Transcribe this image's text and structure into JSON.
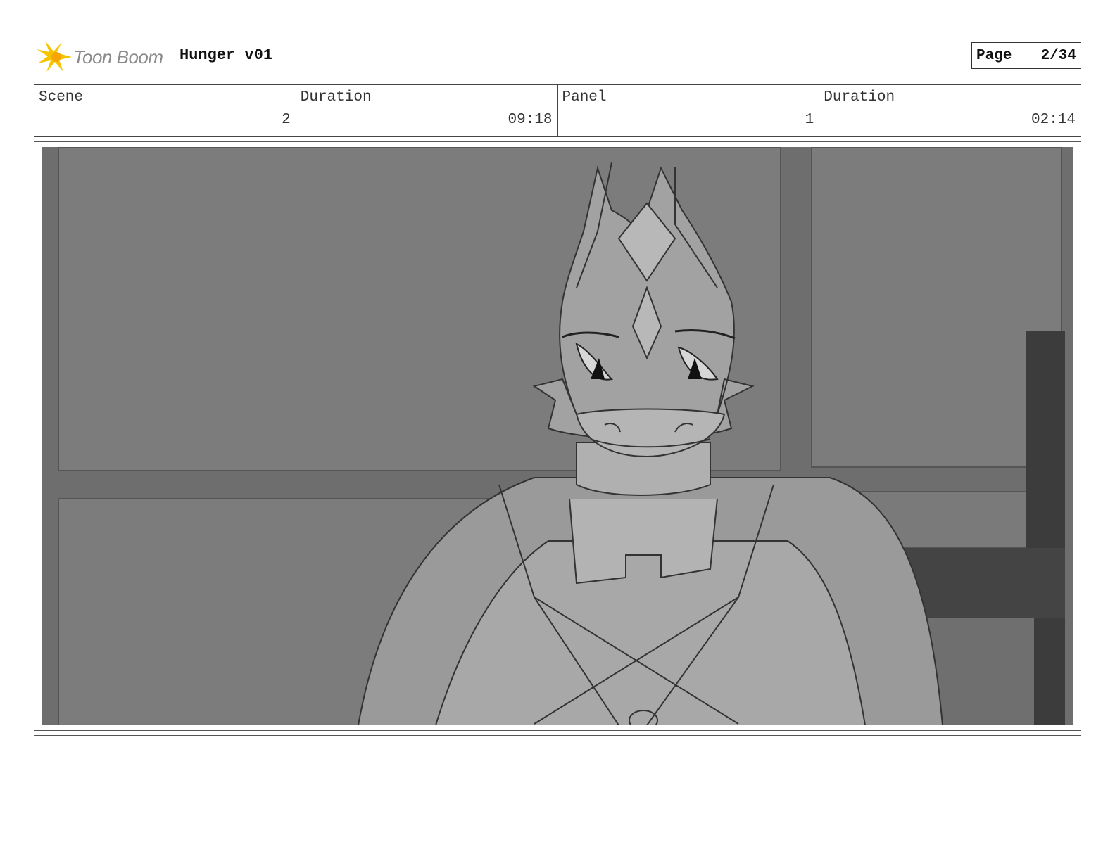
{
  "header": {
    "logo_text": "Toon Boom",
    "project_title": "Hunger v01",
    "page_label": "Page",
    "page_number": "2/34"
  },
  "info": {
    "scene_label": "Scene",
    "scene_value": "2",
    "scene_duration_label": "Duration",
    "scene_duration_value": "09:18",
    "panel_label": "Panel",
    "panel_value": "1",
    "panel_duration_label": "Duration",
    "panel_duration_value": "02:14"
  },
  "caption": {
    "text": ""
  },
  "colors": {
    "logo_accent": "#f5c400",
    "frame_border": "#444444",
    "sketch_background": "#7a7a7a"
  }
}
